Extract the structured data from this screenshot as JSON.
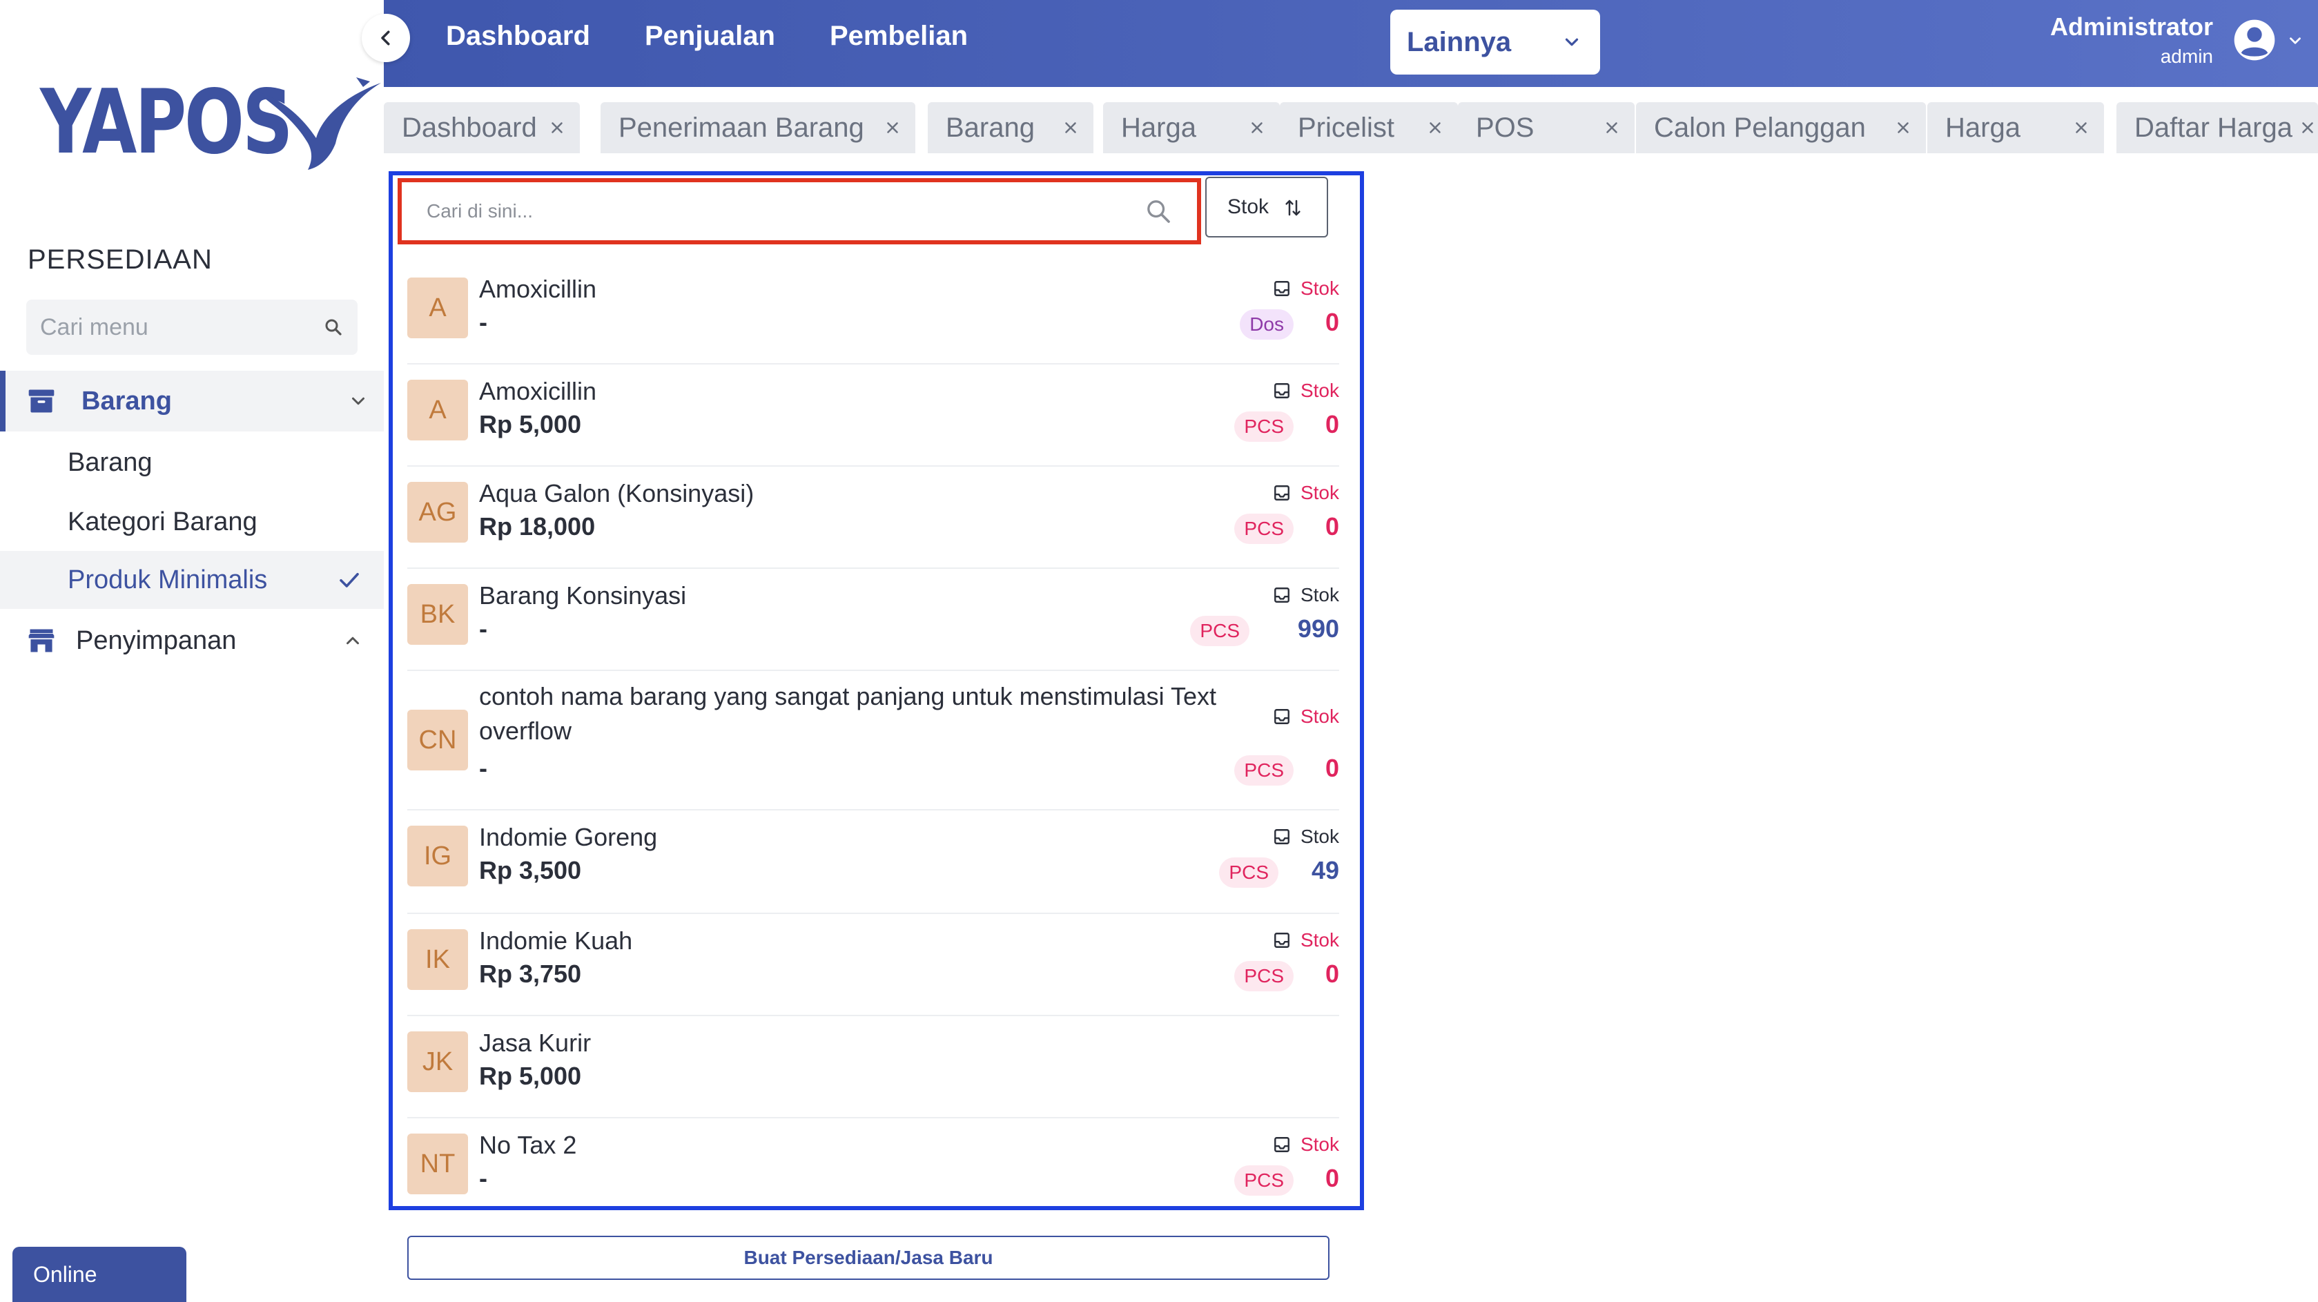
{
  "brand": {
    "name": "YAPOS",
    "color": "#3d52a0"
  },
  "sidebar": {
    "section_title": "PERSEDIAAN",
    "search_placeholder": "Cari menu",
    "groups": [
      {
        "label": "Barang",
        "icon": "archive-box-icon",
        "expanded": true,
        "children": [
          "Barang",
          "Kategori Barang",
          "Produk Minimalis"
        ],
        "selected_child": "Produk Minimalis"
      },
      {
        "label": "Penyimpanan",
        "icon": "store-icon",
        "expanded": false
      }
    ]
  },
  "status": {
    "online_label": "Online"
  },
  "topnav": {
    "links": [
      "Dashboard",
      "Penjualan",
      "Pembelian"
    ],
    "active_dropdown": "Lainnya",
    "user": {
      "name": "Administrator",
      "role": "admin"
    }
  },
  "tabs": [
    "Dashboard",
    "Penerimaan Barang",
    "Barang",
    "Harga",
    "Pricelist",
    "POS",
    "Calon Pelanggan",
    "Harga",
    "Daftar Harga"
  ],
  "list": {
    "search_placeholder": "Cari di sini...",
    "sort_label": "Stok",
    "stock_label": "Stok",
    "items": [
      {
        "initials": "A",
        "name": "Amoxicillin",
        "price": "-",
        "unit": "Dos",
        "qty": "0"
      },
      {
        "initials": "A",
        "name": "Amoxicillin",
        "price": "Rp 5,000",
        "unit": "PCS",
        "qty": "0"
      },
      {
        "initials": "AG",
        "name": "Aqua Galon (Konsinyasi)",
        "price": "Rp 18,000",
        "unit": "PCS",
        "qty": "0"
      },
      {
        "initials": "BK",
        "name": "Barang Konsinyasi",
        "price": "-",
        "unit": "PCS",
        "qty": "990"
      },
      {
        "initials": "CN",
        "name": "contoh nama barang yang sangat panjang untuk menstimulasi Text overflow",
        "price": "-",
        "unit": "PCS",
        "qty": "0"
      },
      {
        "initials": "IG",
        "name": "Indomie Goreng",
        "price": "Rp 3,500",
        "unit": "PCS",
        "qty": "49"
      },
      {
        "initials": "IK",
        "name": "Indomie Kuah",
        "price": "Rp 3,750",
        "unit": "PCS",
        "qty": "0"
      },
      {
        "initials": "JK",
        "name": "Jasa Kurir",
        "price": "Rp 5,000"
      },
      {
        "initials": "NT",
        "name": "No Tax 2",
        "price": "-",
        "unit": "PCS",
        "qty": "0"
      }
    ],
    "create_button": "Buat Persediaan/Jasa Baru"
  },
  "colors": {
    "primary": "#3d52a0",
    "negative_stock": "#e0245e",
    "avatar_bg": "#f1d3bb",
    "avatar_text": "#c07a3c",
    "highlight_red": "#e0331f",
    "highlight_blue": "#1d3fe0"
  }
}
